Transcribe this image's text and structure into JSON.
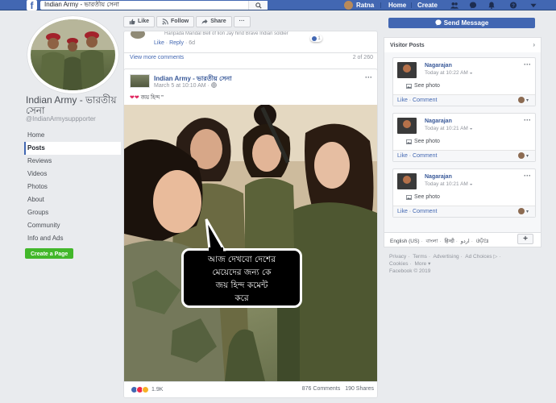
{
  "topbar": {
    "logo": "f",
    "search_value": "Indian Army - ভারতীয় সেনা",
    "user_name": "Ratna",
    "home": "Home",
    "create": "Create"
  },
  "left": {
    "page_name": "Indian Army - ভারতীয় সেনা",
    "page_handle": "@IndianArmysuppporter",
    "nav": [
      "Home",
      "Posts",
      "Reviews",
      "Videos",
      "Photos",
      "About",
      "Groups",
      "Community",
      "Info and Ads"
    ],
    "create_page": "Create a Page"
  },
  "action_bar": {
    "like": "Like",
    "follow": "Follow",
    "share": "Share",
    "more": "···"
  },
  "prev_comments": {
    "snippet": "Haripada Mandal Bell of lion Jay hind Brave Indian soldier",
    "reaction_count": "1",
    "like": "Like",
    "reply": "Reply",
    "age": "6d",
    "view_more": "View more comments",
    "count": "2 of 260"
  },
  "post": {
    "author": "Indian Army - ভারতীয় সেনা",
    "timestamp": "March 5 at 10:10 AM",
    "menu": "···",
    "text": "জয় হিন্দ \"",
    "speech_lines": [
      "আজ দেখবো দেশের",
      "মেয়েদের জন্য কে",
      "জয় হিন্দ কমেন্ট",
      "করে"
    ],
    "reaction_count": "1.9K",
    "comments": "876 Comments",
    "shares": "190 Shares"
  },
  "right": {
    "send_message": "Send Message",
    "visitor_posts_label": "Visitor Posts",
    "visitor_posts": [
      {
        "name": "Nagarajan",
        "time": "Today at 10:22 AM",
        "see_photo": "See photo",
        "actions": "Like · Comment"
      },
      {
        "name": "Nagarajan",
        "time": "Today at 10:21 AM",
        "see_photo": "See photo",
        "actions": "Like · Comment"
      },
      {
        "name": "Nagarajan",
        "time": "Today at 10:21 AM",
        "see_photo": "See photo",
        "actions": "Like · Comment"
      }
    ],
    "languages": [
      "English (US)",
      "বাংলা",
      "हिन्दी",
      "اردو",
      "ଓଡ଼ିଆ"
    ],
    "footer_links": [
      "Privacy",
      "Terms",
      "Advertising",
      "Ad Choices",
      "Cookies",
      "More"
    ],
    "copyright": "Facebook © 2019"
  },
  "colors": {
    "brand": "#4267b2",
    "link": "#385898",
    "green": "#42b72a",
    "background": "#e9ebee"
  }
}
